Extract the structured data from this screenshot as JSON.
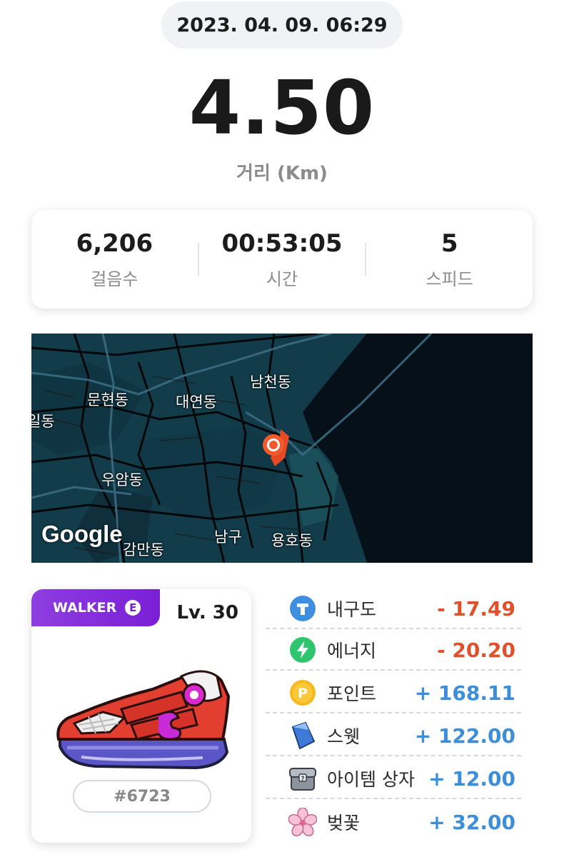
{
  "session": {
    "datetime": "2023. 04. 09. 06:29",
    "distance": "4.50",
    "distance_label": "거리 (Km)"
  },
  "stats": [
    {
      "value": "6,206",
      "label": "걸음수"
    },
    {
      "value": "00:53:05",
      "label": "시간"
    },
    {
      "value": "5",
      "label": "스피드"
    }
  ],
  "map": {
    "labels": [
      "남천동",
      "문현동",
      "대연동",
      "일동",
      "우암동",
      "남구",
      "용호동",
      "감만동"
    ],
    "attribution": "Google",
    "marker_icon": "location-pin-icon"
  },
  "sneaker": {
    "class": "WALKER",
    "grade": "E",
    "level": "Lv. 30",
    "id": "#6723"
  },
  "rewards": [
    {
      "name": "내구도",
      "value": "- 17.49",
      "icon": "durability-icon",
      "color": "#e0502a"
    },
    {
      "name": "에너지",
      "value": "- 20.20",
      "icon": "energy-icon",
      "color": "#e0502a"
    },
    {
      "name": "포인트",
      "value": "+ 168.11",
      "icon": "point-icon",
      "color": "#3d8ed8"
    },
    {
      "name": "스웻",
      "value": "+ 122.00",
      "icon": "sweat-crystal-icon",
      "color": "#3d8ed8"
    },
    {
      "name": "아이템 상자",
      "value": "+ 12.00",
      "icon": "item-box-icon",
      "color": "#3d8ed8"
    },
    {
      "name": "벚꽃",
      "value": "+ 32.00",
      "icon": "cherry-blossom-icon",
      "color": "#3d8ed8"
    }
  ]
}
